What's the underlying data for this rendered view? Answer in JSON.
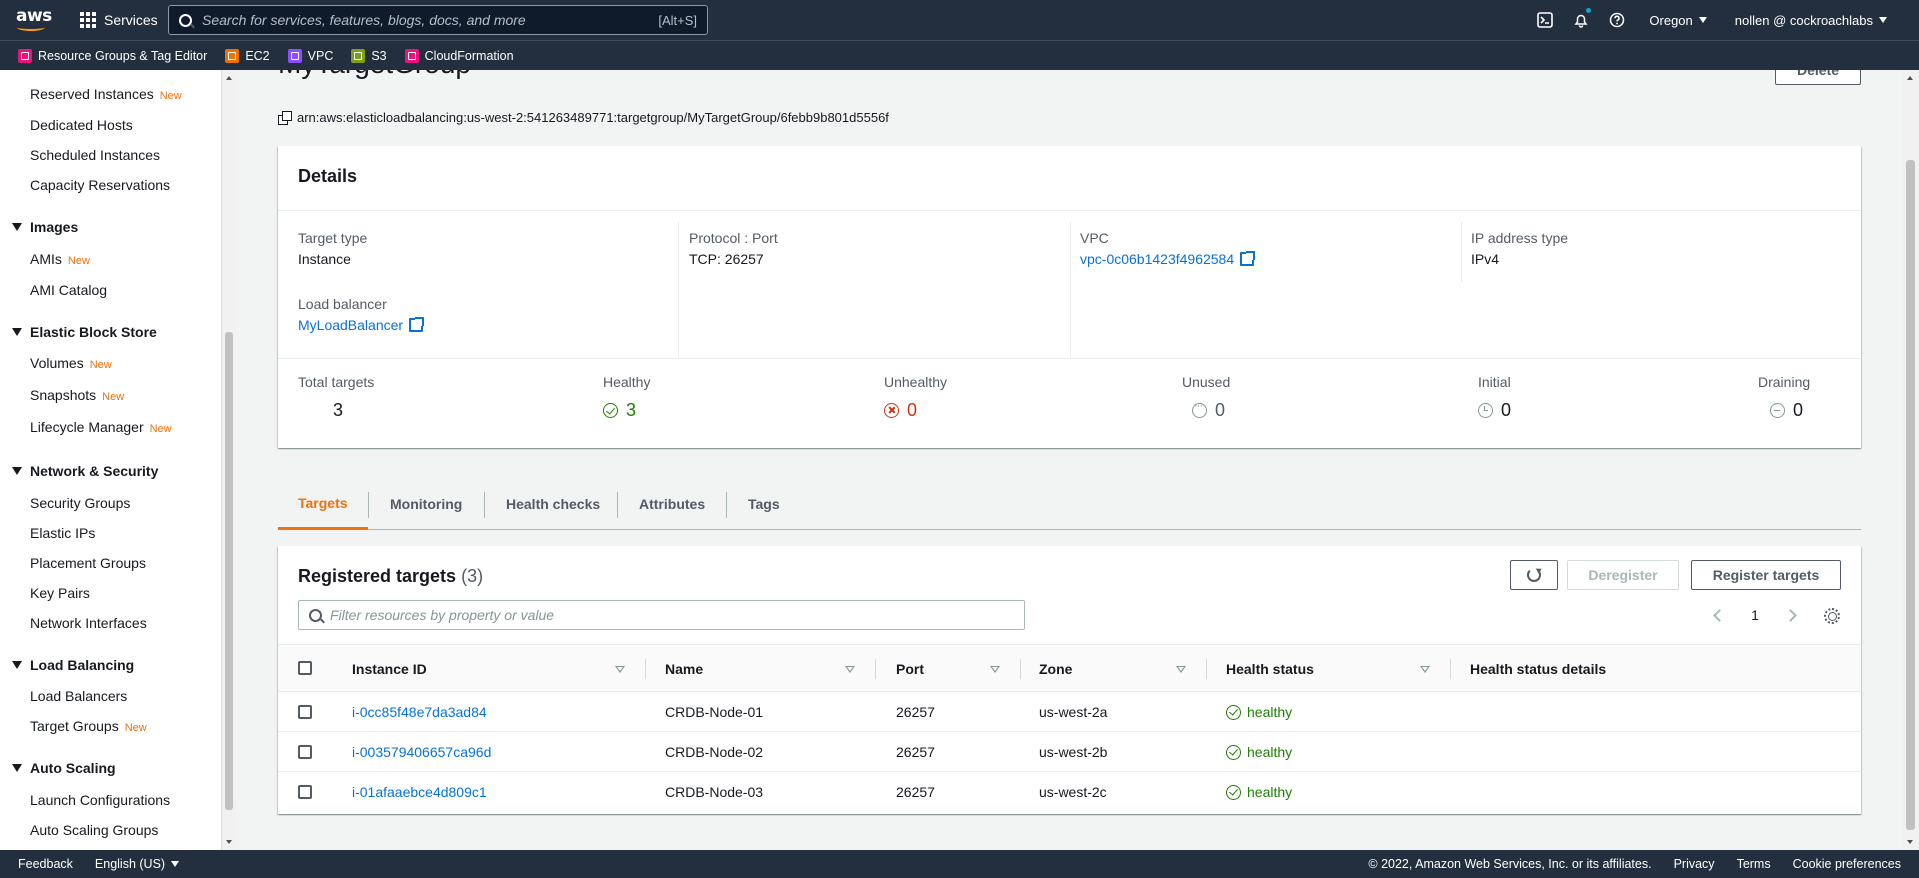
{
  "topnav": {
    "logo": "aws",
    "services_label": "Services",
    "search_placeholder": "Search for services, features, blogs, docs, and more",
    "search_shortcut": "[Alt+S]",
    "region": "Oregon",
    "user": "nollen @ cockroachlabs"
  },
  "favorites": [
    {
      "label": "Resource Groups & Tag Editor",
      "color": "#e7157b"
    },
    {
      "label": "EC2",
      "color": "#ed7100"
    },
    {
      "label": "VPC",
      "color": "#8c4fff"
    },
    {
      "label": "S3",
      "color": "#7aa116"
    },
    {
      "label": "CloudFormation",
      "color": "#e7157b"
    }
  ],
  "sidebar": {
    "new_badge": "New",
    "items": [
      {
        "label": "Reserved Instances",
        "new": true
      },
      {
        "label": "Dedicated Hosts"
      },
      {
        "label": "Scheduled Instances"
      },
      {
        "label": "Capacity Reservations"
      },
      {
        "section": "Images"
      },
      {
        "label": "AMIs",
        "new": true
      },
      {
        "label": "AMI Catalog"
      },
      {
        "section": "Elastic Block Store"
      },
      {
        "label": "Volumes",
        "new": true
      },
      {
        "label": "Snapshots",
        "new": true
      },
      {
        "label": "Lifecycle Manager",
        "new": true
      },
      {
        "section": "Network & Security"
      },
      {
        "label": "Security Groups"
      },
      {
        "label": "Elastic IPs"
      },
      {
        "label": "Placement Groups"
      },
      {
        "label": "Key Pairs"
      },
      {
        "label": "Network Interfaces"
      },
      {
        "section": "Load Balancing"
      },
      {
        "label": "Load Balancers"
      },
      {
        "label": "Target Groups",
        "new": true
      },
      {
        "section": "Auto Scaling"
      },
      {
        "label": "Launch Configurations"
      },
      {
        "label": "Auto Scaling Groups"
      }
    ]
  },
  "page": {
    "title": "MyTargetGroup",
    "delete_label": "Delete",
    "arn": "arn:aws:elasticloadbalancing:us-west-2:541263489771:targetgroup/MyTargetGroup/6febb9b801d5556f"
  },
  "details": {
    "title": "Details",
    "target_type": {
      "label": "Target type",
      "value": "Instance"
    },
    "protocol_port": {
      "label": "Protocol : Port",
      "value": "TCP: 26257"
    },
    "vpc": {
      "label": "VPC",
      "value": "vpc-0c06b1423f4962584"
    },
    "ip_type": {
      "label": "IP address type",
      "value": "IPv4"
    },
    "load_balancer": {
      "label": "Load balancer",
      "value": "MyLoadBalancer"
    },
    "counts": {
      "total": {
        "label": "Total targets",
        "value": "3"
      },
      "healthy": {
        "label": "Healthy",
        "value": "3"
      },
      "unhealthy": {
        "label": "Unhealthy",
        "value": "0"
      },
      "unused": {
        "label": "Unused",
        "value": "0"
      },
      "initial": {
        "label": "Initial",
        "value": "0"
      },
      "draining": {
        "label": "Draining",
        "value": "0"
      }
    }
  },
  "tabs": [
    "Targets",
    "Monitoring",
    "Health checks",
    "Attributes",
    "Tags"
  ],
  "targets": {
    "title": "Registered targets",
    "count": "(3)",
    "deregister_label": "Deregister",
    "register_label": "Register targets",
    "filter_placeholder": "Filter resources by property or value",
    "page_number": "1",
    "columns": [
      "Instance ID",
      "Name",
      "Port",
      "Zone",
      "Health status",
      "Health status details"
    ],
    "rows": [
      {
        "id": "i-0cc85f48e7da3ad84",
        "name": "CRDB-Node-01",
        "port": "26257",
        "zone": "us-west-2a",
        "status": "healthy",
        "details": ""
      },
      {
        "id": "i-003579406657ca96d",
        "name": "CRDB-Node-02",
        "port": "26257",
        "zone": "us-west-2b",
        "status": "healthy",
        "details": ""
      },
      {
        "id": "i-01afaaebce4d809c1",
        "name": "CRDB-Node-03",
        "port": "26257",
        "zone": "us-west-2c",
        "status": "healthy",
        "details": ""
      }
    ]
  },
  "footer": {
    "feedback": "Feedback",
    "language": "English (US)",
    "copyright": "© 2022, Amazon Web Services, Inc. or its affiliates.",
    "privacy": "Privacy",
    "terms": "Terms",
    "cookies": "Cookie preferences"
  },
  "colors": {
    "nav_bg": "#232f3e",
    "link": "#0972d3",
    "accent": "#ec7211",
    "success": "#1d8102",
    "error": "#d13212"
  }
}
